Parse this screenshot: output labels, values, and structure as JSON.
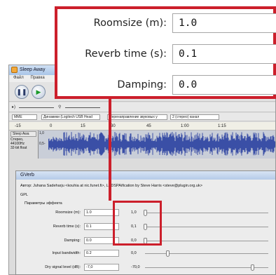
{
  "app": {
    "title": "Sleep Away",
    "menu": [
      "Файл",
      "Правка"
    ],
    "meter_labels": [
      "-15",
      "0",
      "15",
      "30",
      "45",
      "1:00",
      "1:15"
    ],
    "device": {
      "host": "MME",
      "output": "Динамики (Logitech USB Head",
      "input": "Перенаправление звуковых у",
      "channels": "2 (стерео) канал"
    },
    "track": {
      "name": "Sleep Awa",
      "info_line1": "Стерео, 44100Hz",
      "info_line2": "32-bit float",
      "scale_top": "1,0",
      "scale_mid": "0,5-"
    }
  },
  "dialog": {
    "title": "GVerb",
    "author": "Автор: Juhana Sadeharju <kouhia at nic.funet.fi>, LADSPAification by Steve Harris <steve@plugin.org.uk>",
    "license": "GPL",
    "params_header": "Параметры эффекта",
    "params": [
      {
        "label": "Roomsize (m):",
        "value": "1.0",
        "min": "1,0",
        "thumb": 0.0
      },
      {
        "label": "Reverb time (s):",
        "value": "0.1",
        "min": "0,1",
        "thumb": 0.0
      },
      {
        "label": "Damping:",
        "value": "0.0",
        "min": "0,0",
        "thumb": 0.0
      },
      {
        "label": "Input bandwidth:",
        "value": "0.2",
        "min": "0,0",
        "thumb": 0.2
      },
      {
        "label": "Dry signal level (dB):",
        "value": "-7,0",
        "min": "-70,0",
        "thumb": 0.9
      }
    ]
  },
  "zoom": {
    "params": [
      {
        "label": "Roomsize (m):",
        "value": "1.0"
      },
      {
        "label": "Reverb time (s):",
        "value": "0.1"
      },
      {
        "label": "Damping:",
        "value": "0.0"
      }
    ]
  },
  "colors": {
    "highlight": "#cc1f2b",
    "waveform": "#3a4fa6",
    "play": "#1b9a2a"
  },
  "icons": [
    "pause-icon",
    "play-icon",
    "speaker-icon",
    "microphone-icon"
  ]
}
